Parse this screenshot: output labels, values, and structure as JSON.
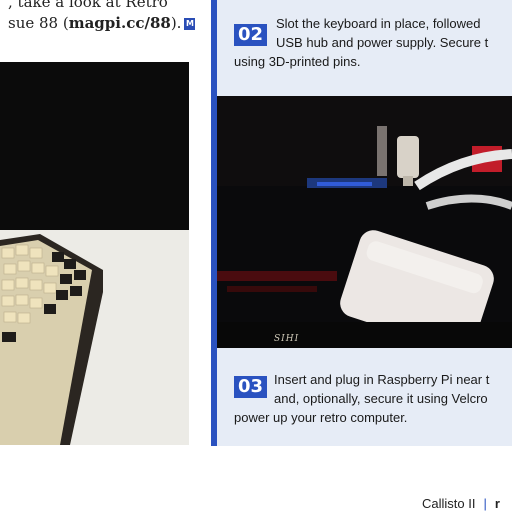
{
  "intro": {
    "line1": ", take a look at Retro",
    "line2_prefix": "sue 88 (",
    "line2_link": "magpi.cc/88",
    "line2_suffix": ").",
    "end_icon": "magpi-logo-icon"
  },
  "steps": [
    {
      "number": "02",
      "lines": [
        "Slot the keyboard in place, followed",
        "USB hub and power supply. Secure t",
        "using 3D-printed pins."
      ]
    },
    {
      "number": "03",
      "lines": [
        "Insert and plug in Raspberry Pi near t",
        "and, optionally, secure it using Velcro",
        "power up your retro computer."
      ]
    }
  ],
  "photo_right": {
    "case_label": "SIHI"
  },
  "footer": {
    "title": "Callisto II",
    "separator": "|",
    "page": "r"
  },
  "colors": {
    "accent_blue": "#2a52c0",
    "panel_bg": "#e6ecf6"
  }
}
